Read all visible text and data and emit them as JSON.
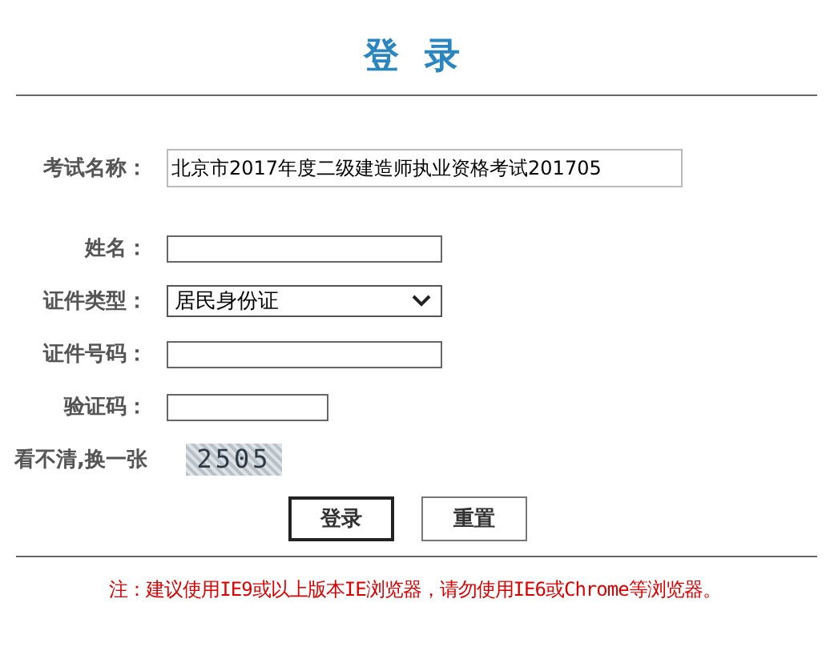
{
  "title": "登 录",
  "fields": [
    {
      "kind": "wide",
      "label": "考试名称：",
      "value": "北京市2017年度二级建造师执业资格考试201705"
    },
    {
      "kind": "text",
      "label": "姓名："
    },
    {
      "kind": "select",
      "label": "证件类型：",
      "value": "居民身份证"
    },
    {
      "kind": "text",
      "label": "证件号码："
    },
    {
      "kind": "short",
      "label": "验证码："
    }
  ],
  "captcha": {
    "link": "看不清,换一张",
    "code": "2505"
  },
  "buttons": [
    {
      "label": "登录",
      "default": true
    },
    {
      "label": "重置",
      "default": false
    }
  ],
  "notice": "注：建议使用IE9或以上版本IE浏览器，请勿使用IE6或Chrome等浏览器。"
}
